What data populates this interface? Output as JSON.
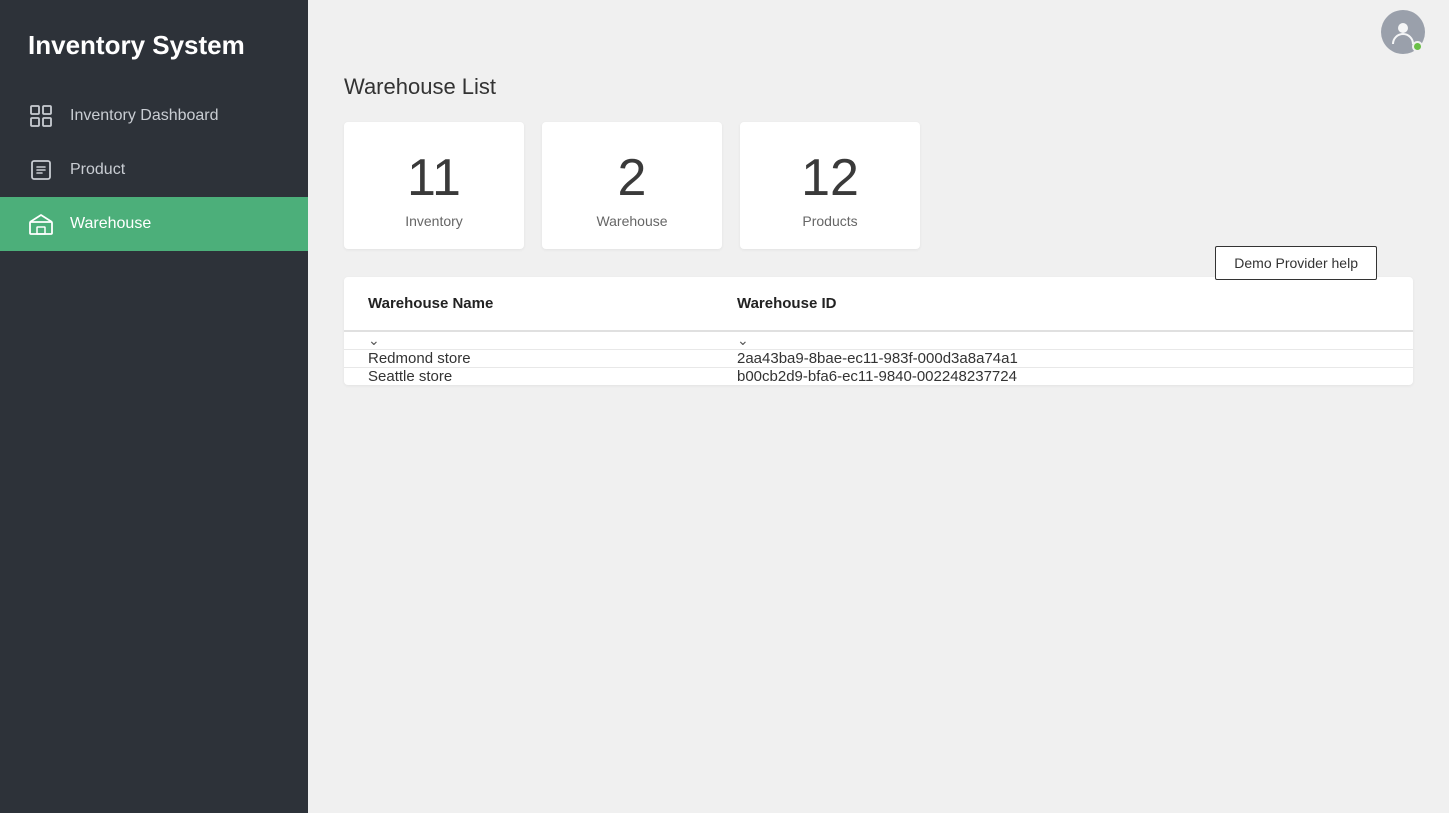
{
  "app": {
    "title": "Inventory System"
  },
  "sidebar": {
    "items": [
      {
        "id": "inventory-dashboard",
        "label": "Inventory Dashboard",
        "icon": "dashboard-icon",
        "active": false
      },
      {
        "id": "product",
        "label": "Product",
        "icon": "product-icon",
        "active": false
      },
      {
        "id": "warehouse",
        "label": "Warehouse",
        "icon": "warehouse-icon",
        "active": true
      }
    ]
  },
  "header": {
    "avatar_status": "online"
  },
  "page": {
    "title": "Warehouse List"
  },
  "stats": [
    {
      "id": "inventory-stat",
      "number": "11",
      "label": "Inventory"
    },
    {
      "id": "warehouse-stat",
      "number": "2",
      "label": "Warehouse"
    },
    {
      "id": "products-stat",
      "number": "12",
      "label": "Products"
    }
  ],
  "help_button": {
    "label": "Demo Provider help"
  },
  "table": {
    "columns": [
      {
        "id": "warehouse-name-col",
        "label": "Warehouse Name"
      },
      {
        "id": "warehouse-id-col",
        "label": "Warehouse ID"
      }
    ],
    "rows": [
      {
        "id": "row-redmond",
        "name": "Redmond store",
        "warehouse_id": "2aa43ba9-8bae-ec11-983f-000d3a8a74a1"
      },
      {
        "id": "row-seattle",
        "name": "Seattle store",
        "warehouse_id": "b00cb2d9-bfa6-ec11-9840-002248237724"
      }
    ]
  }
}
